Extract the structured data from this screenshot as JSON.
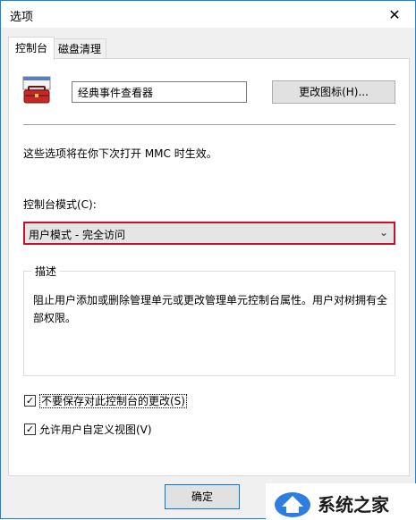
{
  "window": {
    "title": "选项",
    "close_glyph": "✕"
  },
  "tabs": [
    {
      "label": "控制台"
    },
    {
      "label": "磁盘清理"
    }
  ],
  "console": {
    "name_value": "经典事件查看器",
    "change_icon_label": "更改图标(H)...",
    "note": "这些选项将在你下次打开 MMC 时生效。",
    "mode_label": "控制台模式(C):",
    "mode_value": "用户模式 - 完全访问",
    "description_title": "描述",
    "description_text": "阻止用户添加或删除管理单元或更改管理单元控制台属性。用户对树拥有全部权限。",
    "checkboxes": [
      {
        "label": "不要保存对此控制台的更改(S)",
        "checked": true
      },
      {
        "label": "允许用户自定义视图(V)",
        "checked": true
      }
    ]
  },
  "buttons": {
    "ok_label": "确定"
  },
  "watermark": {
    "text": "系统之家"
  }
}
